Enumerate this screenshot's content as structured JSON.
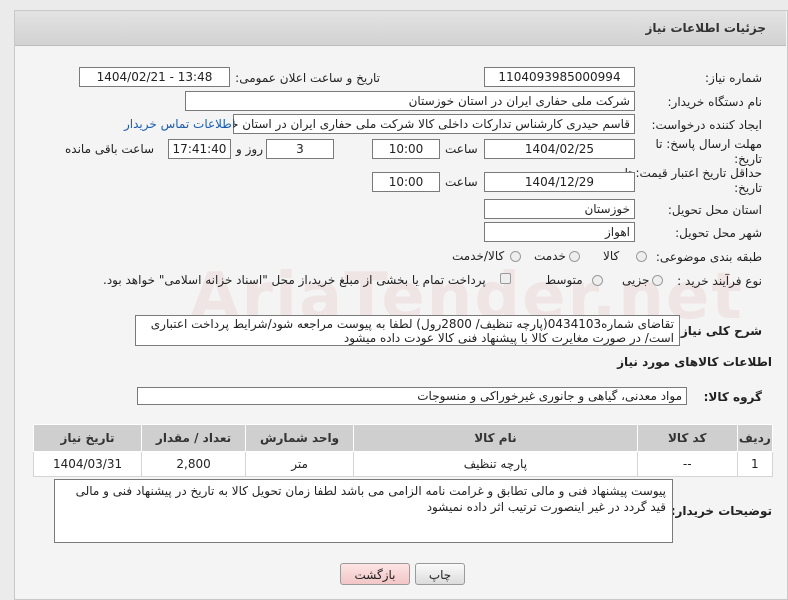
{
  "header": {
    "title": "جزئیات اطلاعات نیاز"
  },
  "watermark": "AriaTender.net",
  "fields": {
    "need_number_label": "شماره نیاز:",
    "need_number": "1104093985000994",
    "announce_label": "تاریخ و ساعت اعلان عمومی:",
    "announce_value": "1404/02/21 - 13:48",
    "buyer_org_label": "نام دستگاه خریدار:",
    "buyer_org": "شرکت ملی حفاری ایران در استان خوزستان",
    "creator_label": "ایجاد کننده درخواست:",
    "creator": "قاسم حیدری کارشناس تدارکات داخلی کالا شرکت ملی حفاری ایران در استان خوزستان",
    "contact_link": "اطلاعات تماس خریدار",
    "reply_deadline_label": "مهلت ارسال پاسخ: تا تاریخ:",
    "reply_date": "1404/02/25",
    "time_label": "ساعت",
    "reply_time": "10:00",
    "days_value": "3",
    "days_label": "روز و",
    "remaining_time": "17:41:40",
    "remaining_label": "ساعت باقی مانده",
    "min_price_label": "حداقل تاریخ اعتبار قیمت: تا تاریخ:",
    "price_date": "1404/12/29",
    "price_time": "10:00",
    "province_label": "استان محل تحویل:",
    "province": "خوزستان",
    "city_label": "شهر محل تحویل:",
    "city": "اهواز",
    "category_label": "طبقه بندی موضوعی:",
    "category_options": [
      "کالا",
      "خدمت",
      "کالا/خدمت"
    ],
    "process_label": "نوع فرآیند خرید :",
    "process_options": [
      "جزیی",
      "متوسط"
    ],
    "payment_note": "پرداخت تمام یا بخشی از مبلغ خرید،از محل \"اسناد خزانه اسلامی\" خواهد بود."
  },
  "description": {
    "label": "شرح کلی نیاز:",
    "text": "تقاضای شماره0434103(پارچه تنظیف/ 2800رول) لطفا به پیوست مراجعه شود/شرایط پرداخت اعتباری است/ در صورت مغایرت کالا با پیشنهاد فنی کالا عودت داده میشود"
  },
  "goods_section": {
    "title": "اطلاعات کالاهای مورد نیاز",
    "group_label": "گروه کالا:",
    "group_value": "مواد معدنی، گیاهی و جانوری غیرخوراکی و منسوجات"
  },
  "table": {
    "headers": [
      "ردیف",
      "کد کالا",
      "نام کالا",
      "واحد شمارش",
      "تعداد / مقدار",
      "تاریخ نیاز"
    ],
    "rows": [
      [
        "1",
        "--",
        "پارچه تنظیف",
        "متر",
        "2,800",
        "1404/03/31"
      ]
    ]
  },
  "buyer_notes": {
    "label": "توضیحات خریدار:",
    "text": "پیوست پیشنهاد فنی و مالی تطابق و غرامت نامه الزامی می باشد لطفا زمان تحویل کالا به تاریخ در پیشنهاد فنی و مالی قید گردد در غیر اینصورت ترتیب اثر داده نمیشود"
  },
  "buttons": {
    "print": "چاپ",
    "back": "بازگشت"
  },
  "colors": {
    "link": "#1b5cb0",
    "back_button_bg": "#f8d7d7"
  }
}
